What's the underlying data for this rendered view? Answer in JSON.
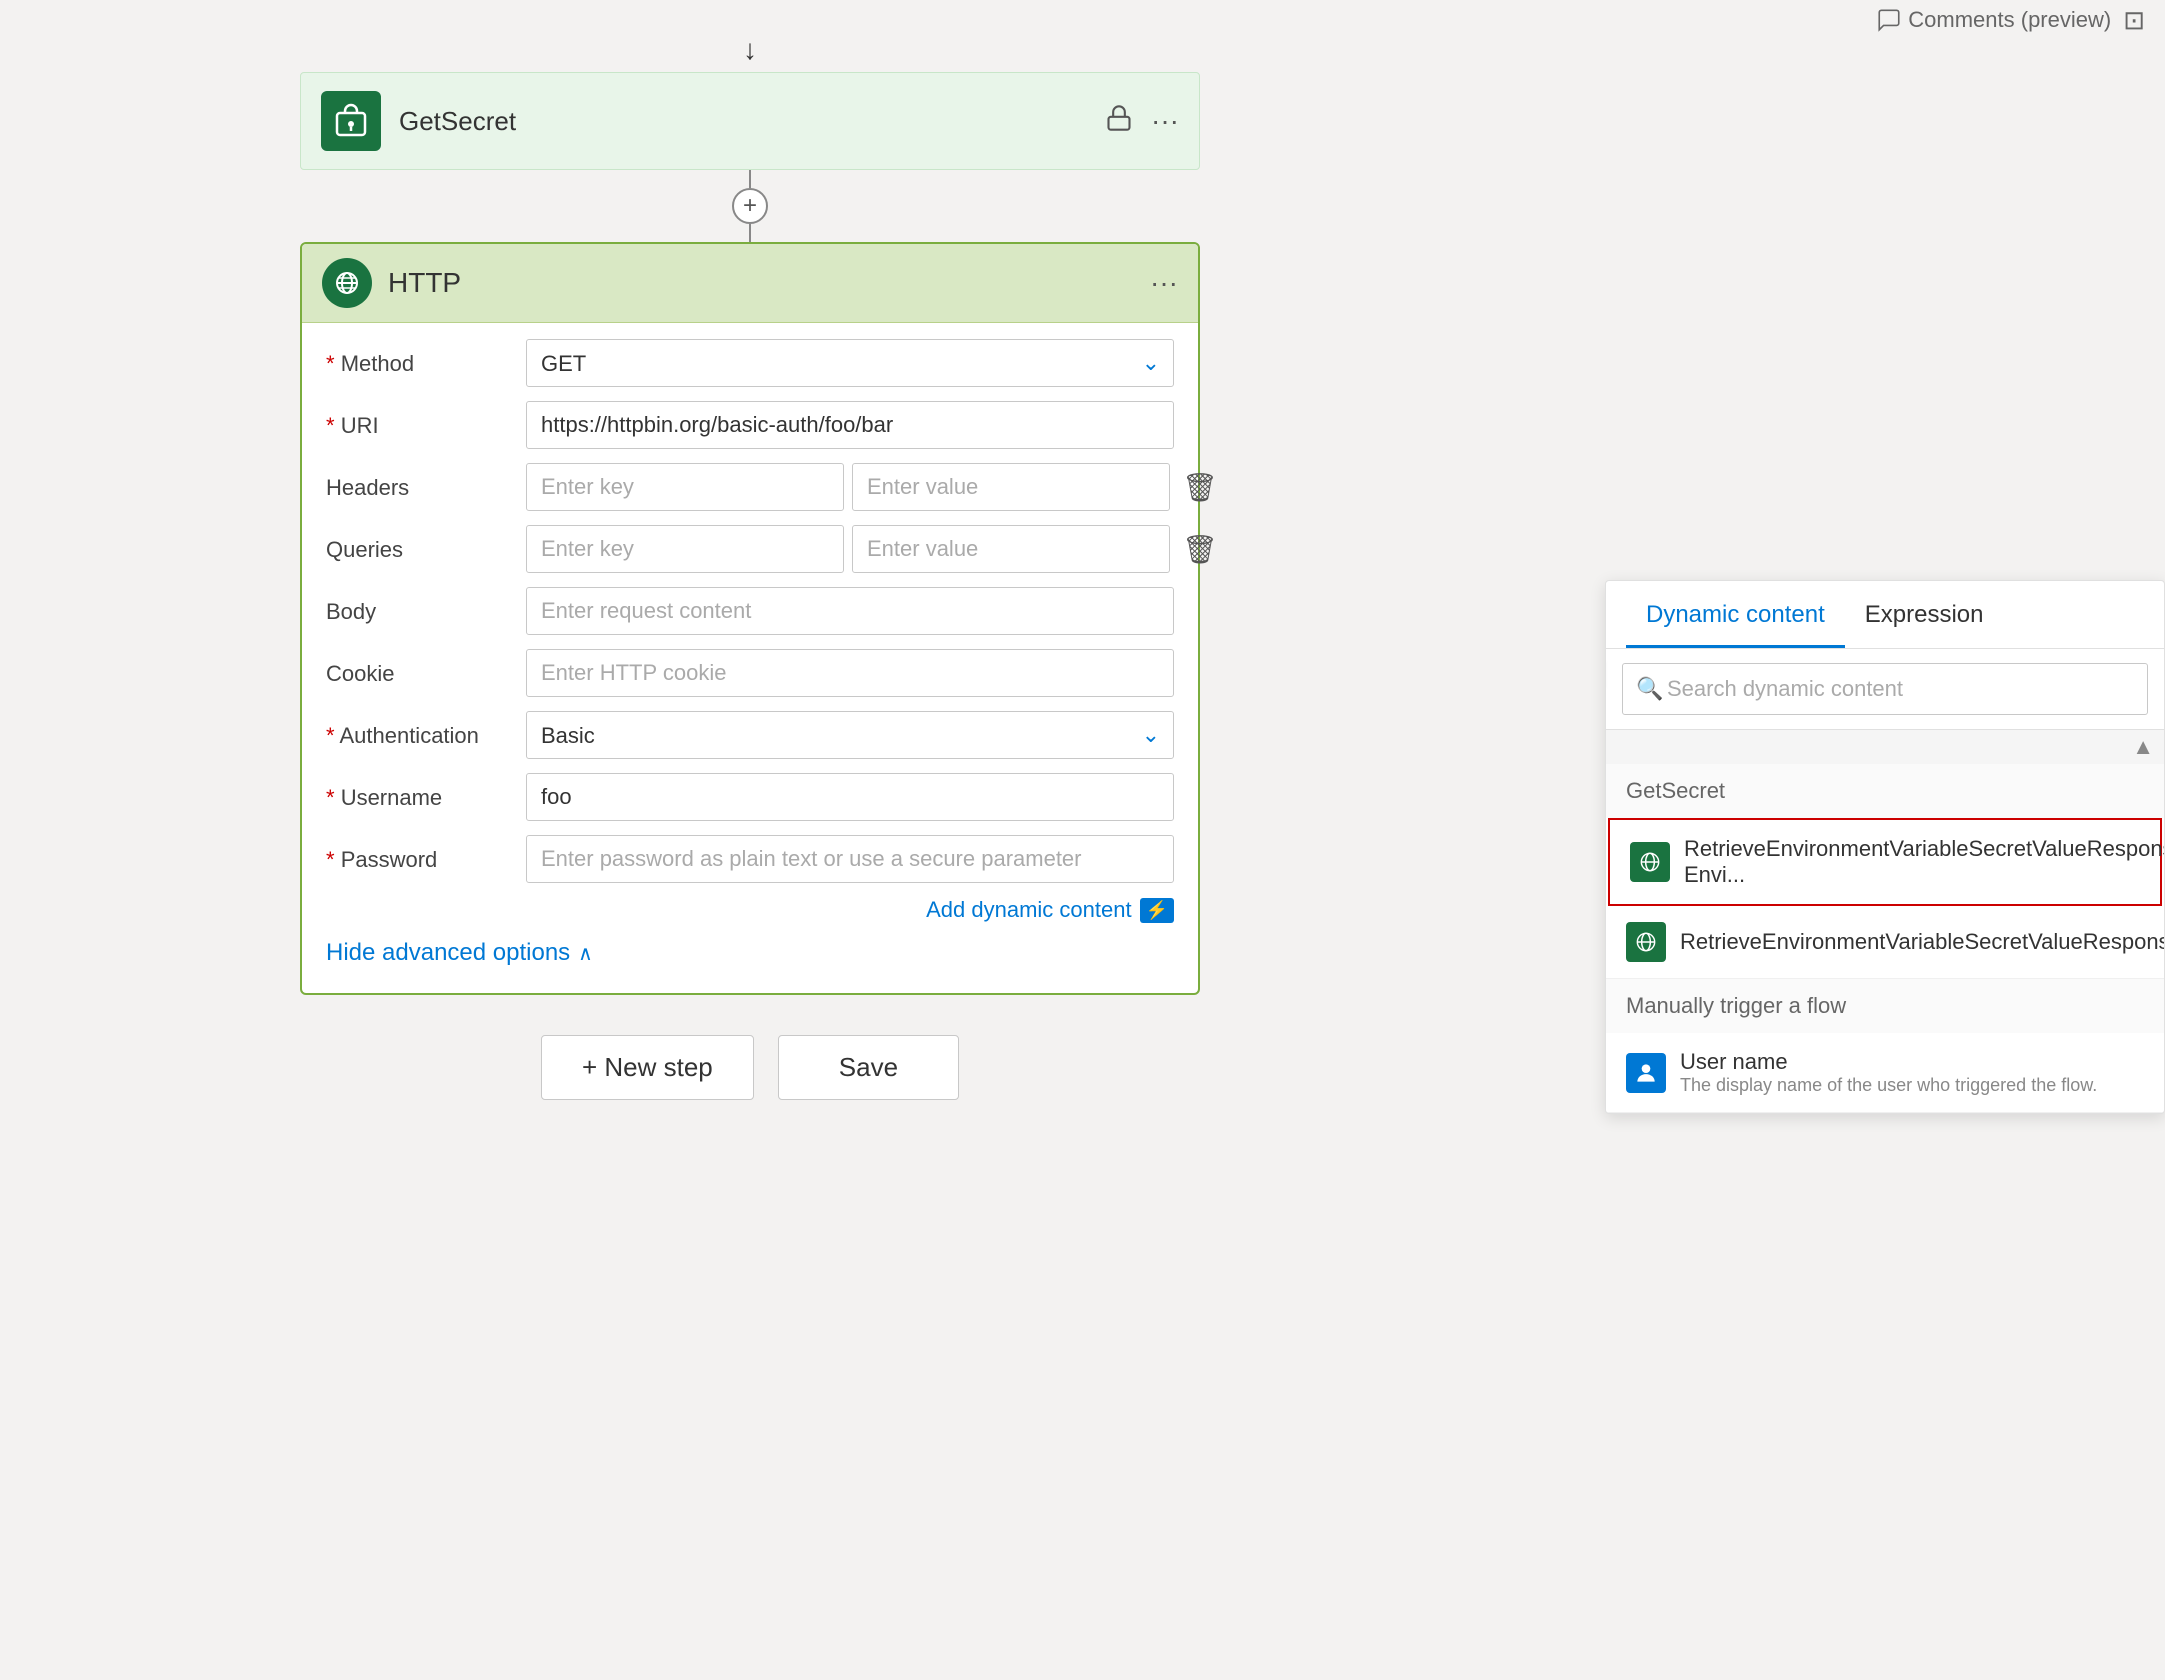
{
  "topbar": {
    "comments_label": "Comments (preview)"
  },
  "getsecret_card": {
    "title": "GetSecret",
    "icon_alt": "getsecret-icon"
  },
  "http_card": {
    "title": "HTTP",
    "icon_alt": "http-icon",
    "fields": {
      "method_label": "Method",
      "method_value": "GET",
      "uri_label": "URI",
      "uri_value": "https://httpbin.org/basic-auth/foo/bar",
      "headers_label": "Headers",
      "headers_key_placeholder": "Enter key",
      "headers_value_placeholder": "Enter value",
      "queries_label": "Queries",
      "queries_key_placeholder": "Enter key",
      "queries_value_placeholder": "Enter value",
      "body_label": "Body",
      "body_placeholder": "Enter request content",
      "cookie_label": "Cookie",
      "cookie_placeholder": "Enter HTTP cookie",
      "authentication_label": "Authentication",
      "authentication_value": "Basic",
      "username_label": "Username",
      "username_value": "foo",
      "password_label": "Password",
      "password_placeholder": "Enter password as plain text or use a secure parameter"
    },
    "dynamic_content_link": "Add dynamic content",
    "hide_advanced": "Hide advanced options"
  },
  "bottom_buttons": {
    "new_step": "+ New step",
    "save": "Save"
  },
  "dynamic_panel": {
    "tab_dynamic": "Dynamic content",
    "tab_expression": "Expression",
    "search_placeholder": "Search dynamic content",
    "section_getsecret": "GetSecret",
    "item1_title": "RetrieveEnvironmentVariableSecretValueResponse Envi...",
    "item2_title": "RetrieveEnvironmentVariableSecretValueResponse",
    "section_manual": "Manually trigger a flow",
    "item3_title": "User name",
    "item3_desc": "The display name of the user who triggered the flow."
  }
}
